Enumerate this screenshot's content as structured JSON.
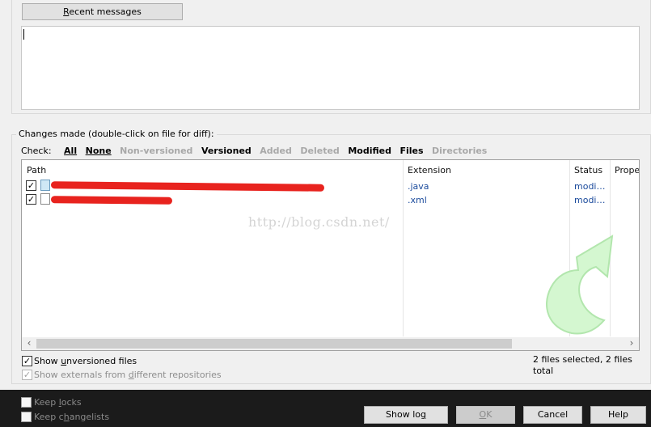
{
  "message": {
    "recent_button": "Recent messages",
    "recent_mnemonic": "R",
    "recent_rest": "ecent messages",
    "text": ""
  },
  "changes": {
    "group_title": "Changes made (double-click on file for diff):",
    "check_label": "Check:",
    "filters": [
      "All",
      "None",
      "Non-versioned",
      "Versioned",
      "Added",
      "Deleted",
      "Modified",
      "Files",
      "Directories"
    ],
    "columns": {
      "path": "Path",
      "extension": "Extension",
      "status": "Status",
      "properties": "Prope"
    },
    "rows": [
      {
        "checked": true,
        "icon": "java-file-icon",
        "path": "",
        "extension": ".java",
        "status": "modi…"
      },
      {
        "checked": true,
        "icon": "xml-file-icon",
        "path": "",
        "extension": ".xml",
        "status": "modi…"
      }
    ],
    "watermark": "http://blog.csdn.net/",
    "selection_status": "2 files selected, 2 files total"
  },
  "options": {
    "show_unversioned": {
      "pre": "Show ",
      "mnemonic": "u",
      "post": "nversioned files",
      "checked": true
    },
    "show_externals": {
      "pre": "Show externals from ",
      "mnemonic": "d",
      "post": "ifferent repositories",
      "checked": true,
      "enabled": false
    }
  },
  "bottom": {
    "keep_locks": {
      "pre": "Keep ",
      "mnemonic": "l",
      "post": "ocks",
      "checked": false
    },
    "keep_changelists": {
      "pre": "Keep c",
      "mnemonic": "h",
      "post": "angelists",
      "checked": false
    },
    "buttons": {
      "show_log": {
        "pre": "Show lo",
        "mnemonic": "g",
        "post": ""
      },
      "ok": {
        "pre": "",
        "mnemonic": "O",
        "post": "K"
      },
      "cancel": "Cancel",
      "help": "Help"
    }
  },
  "colors": {
    "redaction": "#e8231e",
    "bottom_bar": "#1b1b1b",
    "link_blue": "#1a4a9c"
  }
}
